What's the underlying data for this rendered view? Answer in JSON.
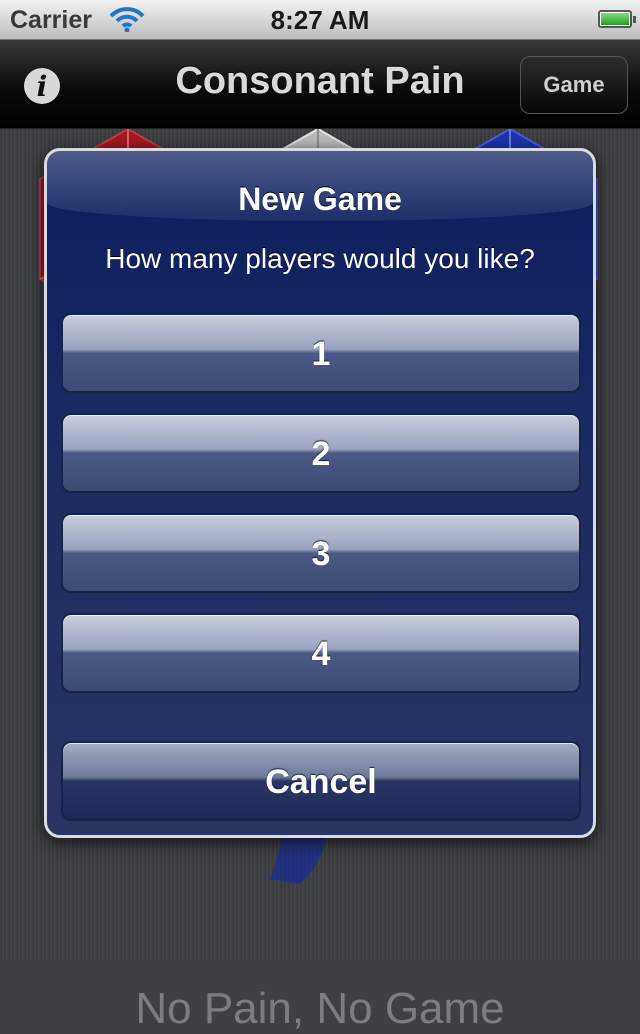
{
  "status_bar": {
    "carrier": "Carrier",
    "time": "8:27 AM",
    "battery_level": 1.0
  },
  "nav_bar": {
    "title": "Consonant Pain",
    "info_icon": "info-icon",
    "info_glyph": "i",
    "game_button": "Game"
  },
  "main": {
    "tagline": "No Pain, No Game"
  },
  "dialog": {
    "title": "New Game",
    "message": "How many players would you like?",
    "buttons": [
      "1",
      "2",
      "3",
      "4"
    ],
    "cancel": "Cancel"
  },
  "colors": {
    "die_red": "#c0121a",
    "die_white": "#d8d8d8",
    "die_blue": "#1734c8",
    "dialog_blue": "#1b2a63"
  }
}
